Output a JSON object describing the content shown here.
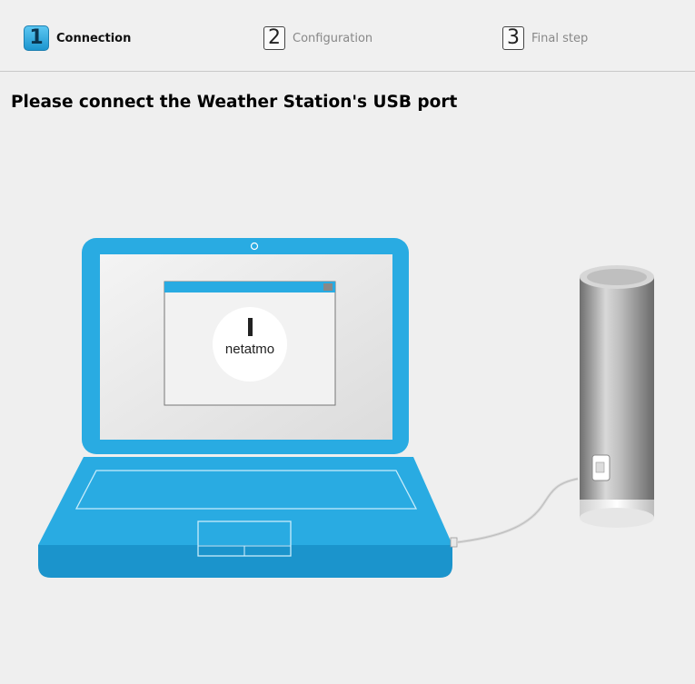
{
  "steps": [
    {
      "number": "1",
      "label": "Connection",
      "active": true
    },
    {
      "number": "2",
      "label": "Configuration",
      "active": false
    },
    {
      "number": "3",
      "label": "Final step",
      "active": false
    }
  ],
  "heading": "Please connect the Weather Station's USB port",
  "illustration": {
    "screen_logo": "netatmo",
    "colors": {
      "laptop": "#29abe2",
      "background": "#efefef",
      "station": "#8a8a8a"
    },
    "icons": [
      "laptop-icon",
      "weather-station-icon",
      "usb-cable-icon",
      "netatmo-logo-icon"
    ]
  }
}
